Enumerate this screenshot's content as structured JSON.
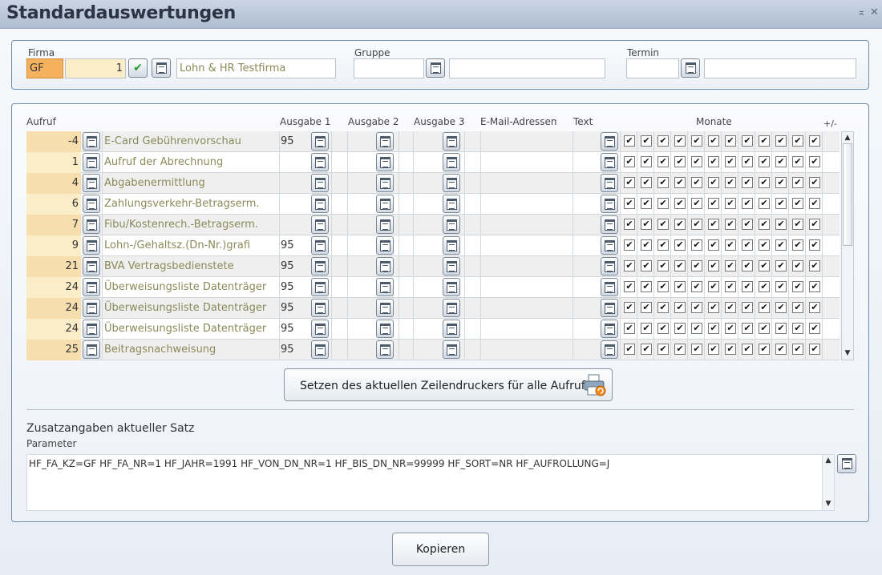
{
  "window": {
    "title": "Standardauswertungen",
    "minimize_glyph": "⌖",
    "close_glyph": "✕"
  },
  "firma": {
    "label": "Firma",
    "kz": "GF",
    "nr": "1",
    "name": "Lohn & HR Testfirma"
  },
  "gruppe": {
    "label": "Gruppe",
    "code": "",
    "name": ""
  },
  "termin": {
    "label": "Termin",
    "code": "",
    "name": ""
  },
  "columns": {
    "aufruf": "Aufruf",
    "ausgabe1": "Ausgabe 1",
    "ausgabe2": "Ausgabe 2",
    "ausgabe3": "Ausgabe 3",
    "email": "E-Mail-Adressen",
    "text": "Text",
    "monate": "Monate",
    "plusminus": "+/-"
  },
  "rows": [
    {
      "nr": "-4",
      "name": "E-Card Gebührenvorschau",
      "a1": "95"
    },
    {
      "nr": "1",
      "name": "Aufruf der Abrechnung",
      "a1": ""
    },
    {
      "nr": "4",
      "name": "Abgabenermittlung",
      "a1": ""
    },
    {
      "nr": "6",
      "name": "Zahlungsverkehr-Betragserm.",
      "a1": ""
    },
    {
      "nr": "7",
      "name": "Fibu/Kostenrech.-Betragserm.",
      "a1": ""
    },
    {
      "nr": "9",
      "name": "Lohn-/Gehaltsz.(Dn-Nr.)grafi",
      "a1": "95"
    },
    {
      "nr": "21",
      "name": "BVA Vertragsbedienstete",
      "a1": "95"
    },
    {
      "nr": "24",
      "name": "Überweisungsliste Datenträger",
      "a1": "95"
    },
    {
      "nr": "24",
      "name": "Überweisungsliste Datenträger",
      "a1": "95"
    },
    {
      "nr": "24",
      "name": "Überweisungsliste Datenträger",
      "a1": "95"
    },
    {
      "nr": "25",
      "name": "Beitragsnachweisung",
      "a1": "95"
    }
  ],
  "months_checked": [
    true,
    true,
    true,
    true,
    true,
    true,
    true,
    true,
    true,
    true,
    true,
    true
  ],
  "check_glyph": "✔",
  "printer_button": {
    "label": "Setzen des aktuellen Zeilendruckers für alle Aufrufe"
  },
  "zusatz": {
    "title": "Zusatzangaben aktueller Satz",
    "param_label": "Parameter",
    "param_value": "HF_FA_KZ=GF HF_FA_NR=1 HF_JAHR=1991 HF_VON_DN_NR=1 HF_BIS_DN_NR=99999 HF_SORT=NR HF_AUFROLLUNG=J"
  },
  "copy_button": {
    "label": "Kopieren"
  },
  "scroll": {
    "up": "▲",
    "down": "▼"
  }
}
